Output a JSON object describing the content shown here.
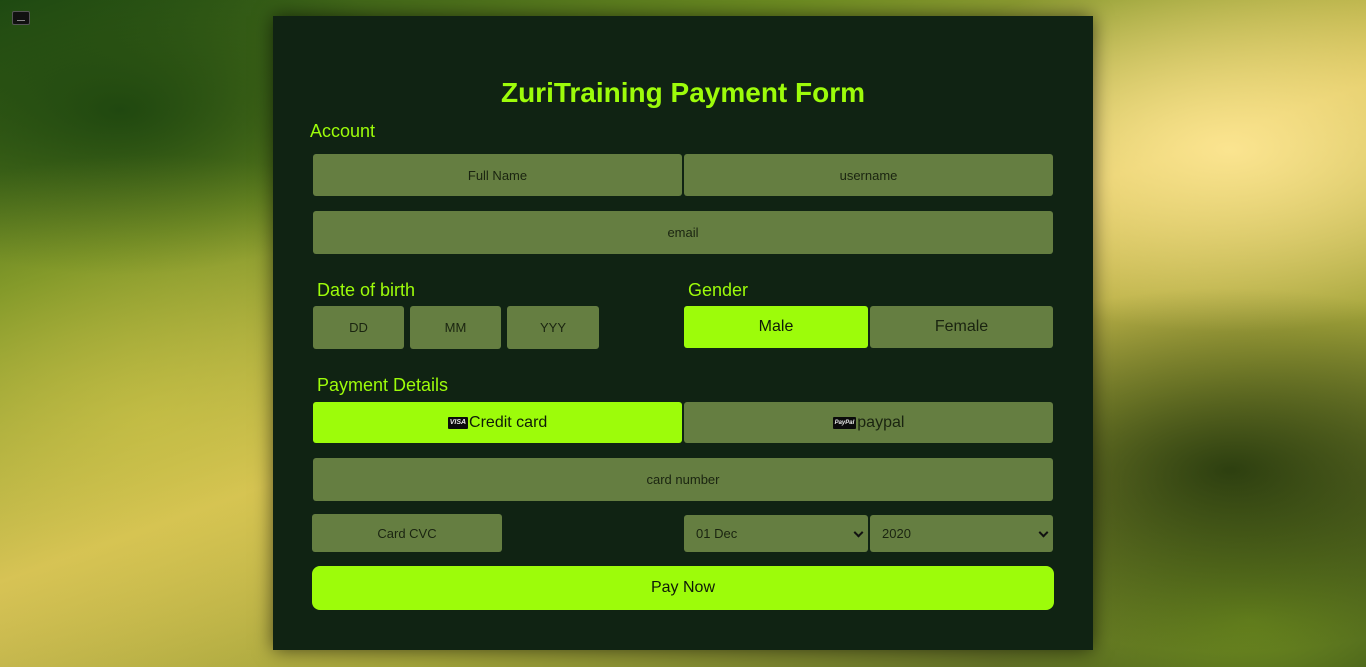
{
  "form": {
    "title": "ZuriTraining Payment Form",
    "account_label": "Account",
    "full_name_placeholder": "Full Name",
    "username_placeholder": "username",
    "email_placeholder": "email",
    "dob_label": "Date of birth",
    "dob_day_placeholder": "DD",
    "dob_month_placeholder": "MM",
    "dob_year_placeholder": "YYY",
    "gender_label": "Gender",
    "gender_male": "Male",
    "gender_female": "Female",
    "gender_selected": "Male",
    "payment_label": "Payment Details",
    "credit_card_label": "Credit card",
    "credit_card_logo": "VISA",
    "paypal_label": "paypal",
    "paypal_logo": "PayPal",
    "payment_selected": "Credit card",
    "card_number_placeholder": "card number",
    "card_cvc_placeholder": "Card CVC",
    "expiry_month_value": "01 Dec",
    "expiry_year_value": "2020",
    "pay_button": "Pay Now"
  },
  "colors": {
    "accent": "#9dfc0a",
    "card_bg": "#102313",
    "field_bg": "#657e41"
  },
  "icons": {
    "desktop_icon": "window-icon",
    "credit_card_icon": "visa-card-icon",
    "paypal_icon": "paypal-card-icon",
    "select_caret": "chevron-down-icon"
  }
}
